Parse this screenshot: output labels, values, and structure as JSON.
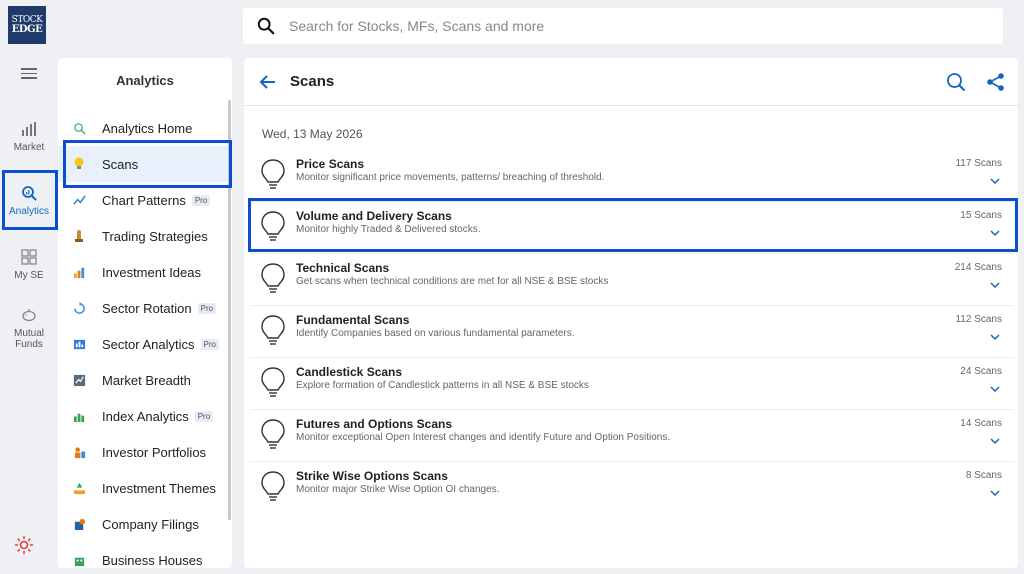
{
  "logo": {
    "line1": "STOCK",
    "line2": "EDGE"
  },
  "search": {
    "placeholder": "Search for Stocks, MFs, Scans and more"
  },
  "rail": {
    "items": [
      {
        "label": "Market",
        "icon": "bar-chart-icon"
      },
      {
        "label": "Analytics",
        "icon": "analytics-search-icon",
        "active": true
      },
      {
        "label": "My SE",
        "icon": "grid-icon"
      },
      {
        "label": "Mutual Funds",
        "line1": "Mutual",
        "line2": "Funds",
        "icon": "piggy-bank-icon"
      }
    ]
  },
  "submenu": {
    "title": "Analytics",
    "items": [
      {
        "label": "Analytics Home",
        "pro": ""
      },
      {
        "label": "Scans",
        "pro": ""
      },
      {
        "label": "Chart Patterns",
        "pro": "Pro"
      },
      {
        "label": "Trading Strategies",
        "pro": ""
      },
      {
        "label": "Investment Ideas",
        "pro": ""
      },
      {
        "label": "Sector Rotation",
        "pro": "Pro"
      },
      {
        "label": "Sector Analytics",
        "pro": "Pro"
      },
      {
        "label": "Market Breadth",
        "pro": ""
      },
      {
        "label": "Index Analytics",
        "pro": "Pro"
      },
      {
        "label": "Investor Portfolios",
        "pro": ""
      },
      {
        "label": "Investment Themes",
        "pro": ""
      },
      {
        "label": "Company Filings",
        "pro": ""
      },
      {
        "label": "Business Houses",
        "pro": ""
      }
    ]
  },
  "main": {
    "title": "Scans",
    "date": "Wed, 13 May 2026",
    "scans": [
      {
        "title": "Price Scans",
        "desc": "Monitor significant price movements, patterns/ breaching of threshold.",
        "count": "117 Scans"
      },
      {
        "title": "Volume and Delivery Scans",
        "desc": "Monitor highly Traded & Delivered stocks.",
        "count": "15 Scans"
      },
      {
        "title": "Technical Scans",
        "desc": "Get scans when technical conditions are met for all NSE & BSE stocks",
        "count": "214 Scans"
      },
      {
        "title": "Fundamental Scans",
        "desc": "Identify Companies based on various fundamental parameters.",
        "count": "112 Scans"
      },
      {
        "title": "Candlestick Scans",
        "desc": "Explore formation of Candlestick patterns in all NSE & BSE stocks",
        "count": "24 Scans"
      },
      {
        "title": "Futures and Options Scans",
        "desc": "Monitor exceptional Open Interest changes and identify Future and Option Positions.",
        "count": "14 Scans"
      },
      {
        "title": "Strike Wise Options Scans",
        "desc": "Monitor major Strike Wise Option OI changes.",
        "count": "8 Scans"
      }
    ]
  },
  "colors": {
    "accent": "#1565c0",
    "highlight": "#0a4fd0",
    "sun": "#e53935"
  }
}
